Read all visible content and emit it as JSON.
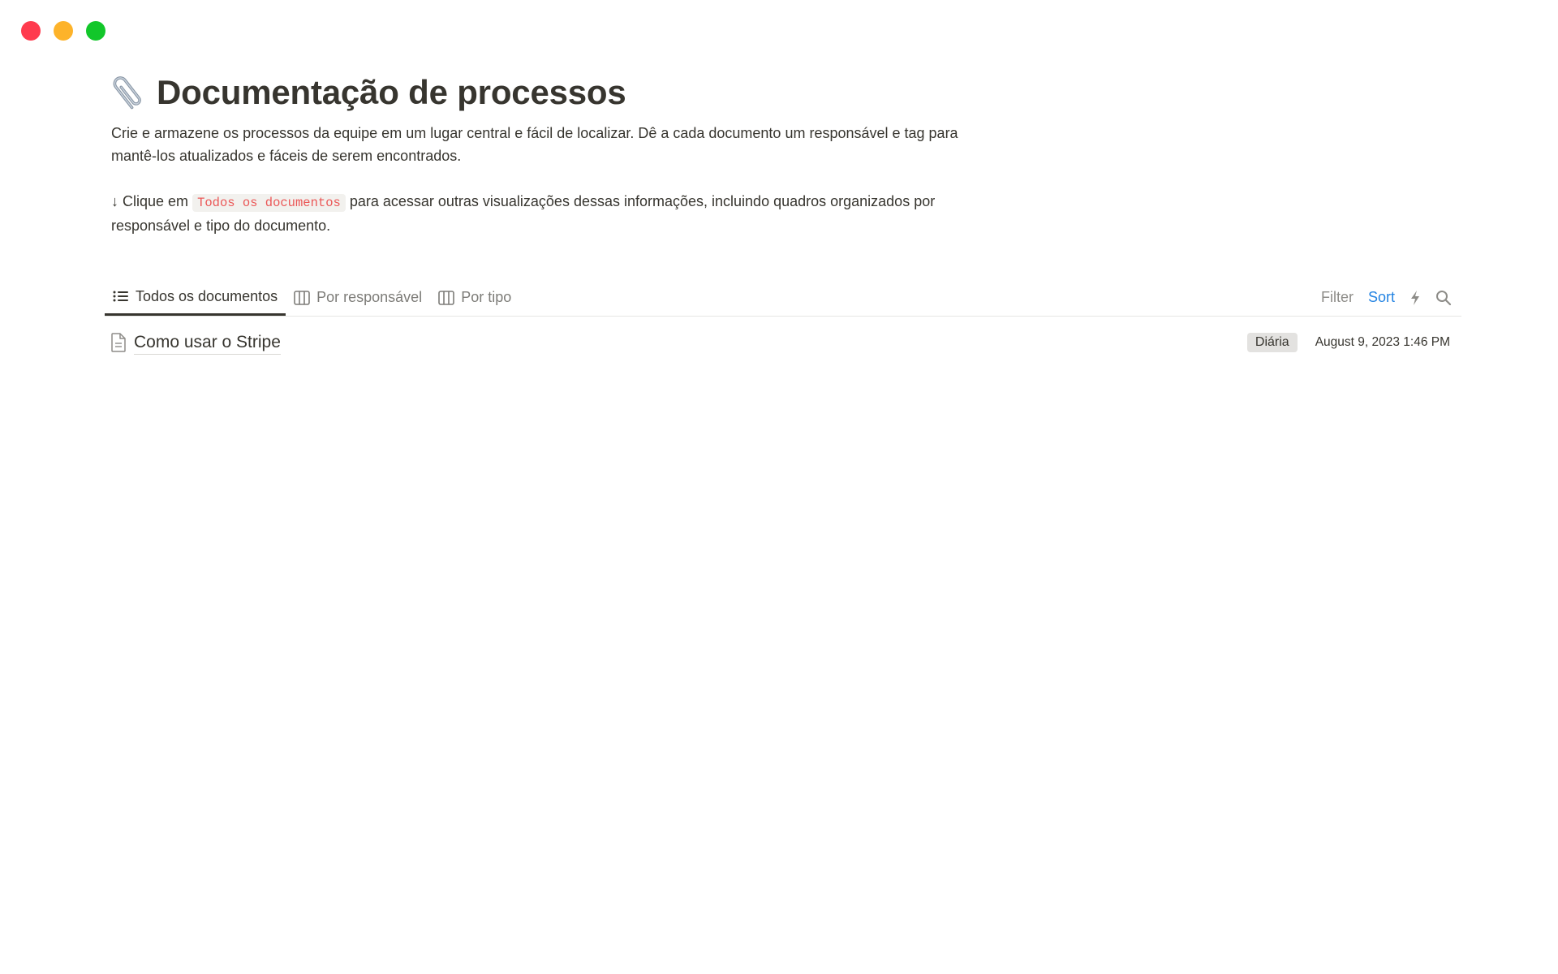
{
  "window": {
    "controls": [
      "close",
      "minimize",
      "maximize"
    ]
  },
  "page": {
    "icon": "paperclip-icon",
    "title": "Documentação de processos",
    "description_1": "Crie e armazene os processos da equipe em um lugar central e fácil de localizar. Dê a cada documento um responsável e tag para mantê-los atualizados e fáceis de serem encontrados.",
    "description_2_prefix": "↓ Clique em",
    "description_2_code": "Todos os documentos",
    "description_2_suffix": "para acessar outras visualizações dessas informações, incluindo quadros organizados por responsável e tipo do documento."
  },
  "tabs": [
    {
      "label": "Todos os documentos",
      "icon": "list-icon",
      "active": true
    },
    {
      "label": "Por responsável",
      "icon": "board-icon",
      "active": false
    },
    {
      "label": "Por tipo",
      "icon": "board-icon",
      "active": false
    }
  ],
  "toolbar": {
    "filter_label": "Filter",
    "sort_label": "Sort",
    "automation_icon": "lightning-icon",
    "search_icon": "search-icon"
  },
  "rows": [
    {
      "icon": "document-icon",
      "title": "Como usar o Stripe",
      "tag": "Diária",
      "date": "August 9, 2023 1:46 PM"
    }
  ],
  "colors": {
    "accent_sort": "#2383e2",
    "code_text": "#eb5757",
    "tag_bg": "#e3e2e0",
    "close": "#ff3b4e",
    "minimize": "#fdb32a",
    "maximize": "#12c72a"
  }
}
